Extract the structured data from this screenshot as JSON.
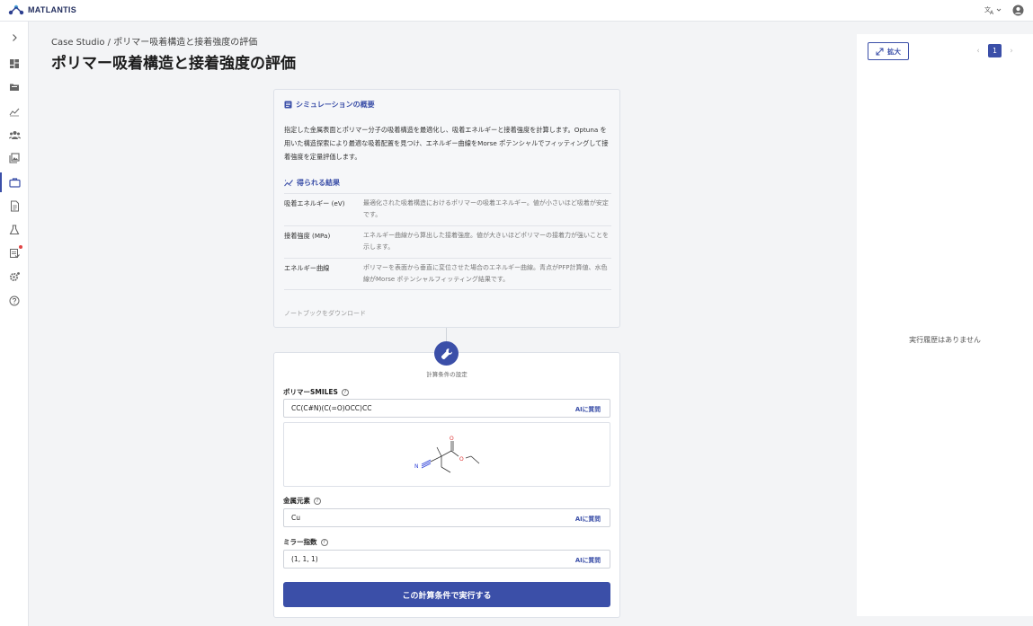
{
  "app": {
    "brand": "MATLANTIS"
  },
  "header": {
    "breadcrumb": "Case Studio  /  ポリマー吸着構造と接着強度の評価",
    "title": "ポリマー吸着構造と接着強度の評価"
  },
  "sidebar": {
    "items": [
      {
        "icon": "chevron-right-icon"
      },
      {
        "icon": "dashboard-icon"
      },
      {
        "icon": "folder-icon"
      },
      {
        "icon": "chart-icon"
      },
      {
        "icon": "users-icon"
      },
      {
        "icon": "gallery-icon"
      },
      {
        "icon": "briefcase-icon",
        "active": true
      },
      {
        "icon": "document-icon"
      },
      {
        "icon": "flask-icon"
      },
      {
        "icon": "notifications-icon",
        "badge": true
      },
      {
        "icon": "settings-icon"
      },
      {
        "icon": "help-icon"
      }
    ]
  },
  "overview": {
    "title": "シミュレーションの概要",
    "description": "指定した金属表面とポリマー分子の吸着構造を最適化し、吸着エネルギーと接着強度を計算します。Optuna を用いた構造探索により最適な吸着配置を見つけ、エネルギー曲線をMorse ポテンシャルでフィッティングして接着強度を定量評価します。",
    "results_title": "得られる結果",
    "results": [
      {
        "name": "吸着エネルギー (eV)",
        "desc": "最適化された吸着構造におけるポリマーの吸着エネルギー。値が小さいほど吸着が安定です。"
      },
      {
        "name": "接着強度 (MPa)",
        "desc": "エネルギー曲線から算出した接着強度。値が大きいほどポリマーの接着力が強いことを示します。"
      },
      {
        "name": "エネルギー曲線",
        "desc": "ポリマーを表面から垂直に変位させた場合のエネルギー曲線。青点がPFP計算値、水色線がMorse ポテンシャルフィッティング結果です。"
      }
    ],
    "download_link": "ノートブックをダウンロード"
  },
  "settings": {
    "caption": "計算条件の設定",
    "smiles_label": "ポリマーSMILES",
    "smiles_value": "CC(C#N)(C(=O)OCC)CC",
    "metal_label": "金属元素",
    "metal_value": "Cu",
    "miller_label": "ミラー指数",
    "miller_value": "(1, 1, 1)",
    "ai_label": "AIに質問",
    "run_button": "この計算条件で実行する"
  },
  "right_panel": {
    "expand_label": "拡大",
    "current_page": "1",
    "empty_text": "実行履歴はありません"
  },
  "colors": {
    "accent": "#3b4fa8"
  }
}
